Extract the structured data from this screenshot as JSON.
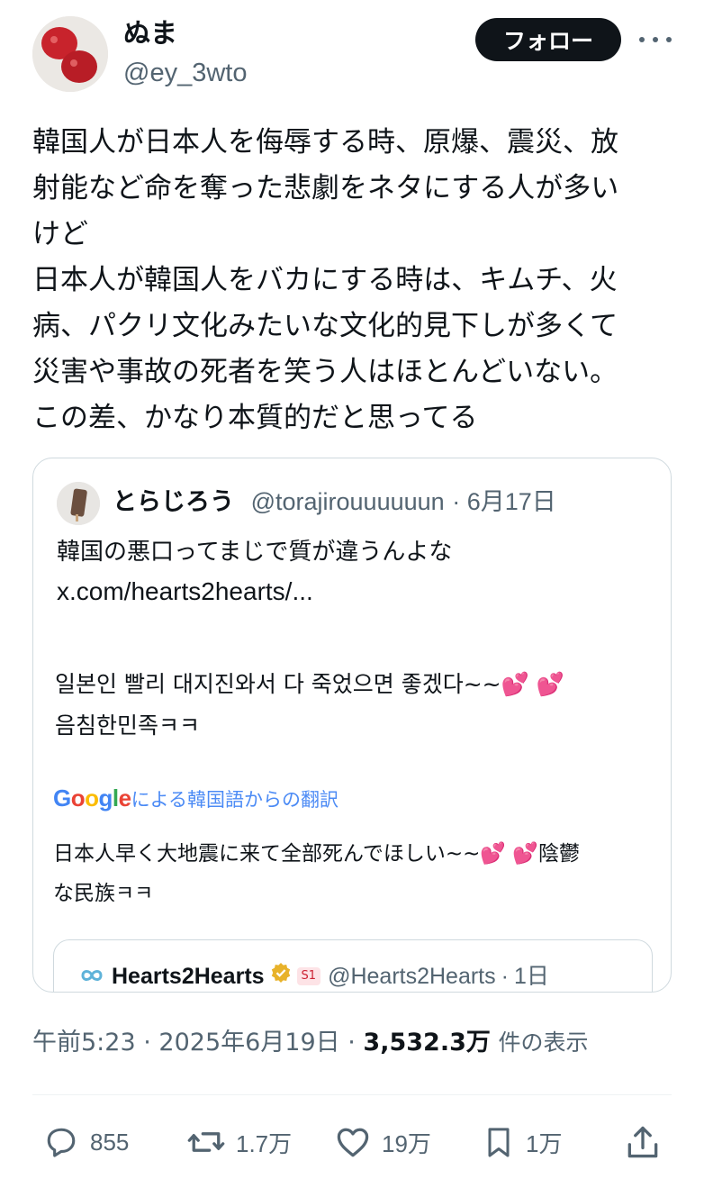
{
  "author": {
    "name": "ぬま",
    "handle": "@ey_3wto",
    "follow_label": "フォロー"
  },
  "tweet": {
    "lines": [
      "韓国人が日本人を侮辱する時、原爆、震災、放",
      "射能など命を奪った悲劇をネタにする人が多い",
      "けど",
      "日本人が韓国人をバカにする時は、キムチ、火",
      "病、パクリ文化みたいな文化的見下しが多くて",
      "災害や事故の死者を笑う人はほとんどいない。",
      "この差、かなり本質的だと思ってる"
    ]
  },
  "quote": {
    "name": "とらじろう",
    "handle": "@torajirouuuuuun",
    "date": "6月17日",
    "text_line1": "韓国の悪口ってまじで質が違うんよな",
    "link": "x.com/hearts2hearts/...",
    "korean_line1": "일본인 빨리 대지진와서 다 죽었으면 좋겠다~~",
    "korean_line2": "음침한민족ㅋㅋ",
    "translation_label": "による韓国語からの翻訳",
    "translation_line1": "日本人早く大地震に来て全部死んでほしい~~",
    "translation_line1_tail": "陰鬱",
    "translation_line2": "な民族ㅋㅋ",
    "heart_emoji": "💕",
    "inner": {
      "name": "Hearts2Hearts",
      "badge": "S1",
      "handle": "@Hearts2Hearts",
      "date": "1日"
    }
  },
  "meta": {
    "time": "午前5:23",
    "date": "2025年6月19日",
    "views": "3,532.3万",
    "views_label": "件の表示"
  },
  "actions": {
    "replies": "855",
    "reposts": "1.7万",
    "likes": "19万",
    "bookmarks": "1万"
  },
  "icons": [
    "more-icon",
    "reply-icon",
    "repost-icon",
    "like-icon",
    "bookmark-icon",
    "share-icon",
    "verified-icon",
    "google-logo"
  ],
  "colors": {
    "text": "#0f1419",
    "secondary": "#536471",
    "border": "#cfd9de",
    "google_blue": "#4285f4",
    "verified_gold": "#e8b22a",
    "heart": "#e0308f"
  }
}
